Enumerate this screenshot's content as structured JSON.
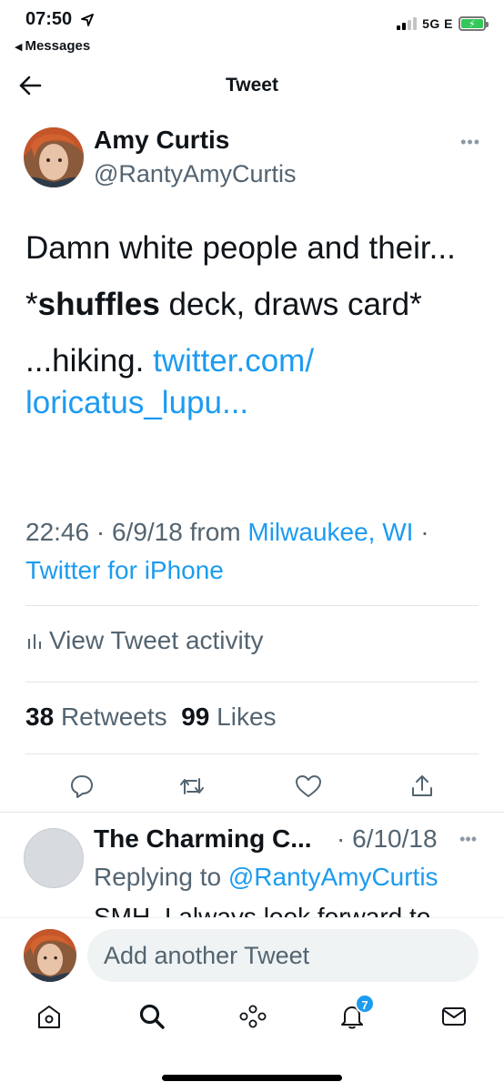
{
  "status": {
    "time": "07:50",
    "back_app": "Messages",
    "network": "5G E"
  },
  "nav": {
    "title": "Tweet"
  },
  "tweet": {
    "author_name": "Amy Curtis",
    "author_handle": "@RantyAmyCurtis",
    "line1": "Damn white people and their...",
    "line2_prefix": "*",
    "line2_bold": "shuffles",
    "line2_rest": " deck, draws card*",
    "line3_text": "...hiking. ",
    "line3_link": "twitter.com/ loricatus_lupu...",
    "time": "22:46",
    "date": "6/9/18",
    "from_label": "from",
    "location": "Milwaukee, WI",
    "client": "Twitter for iPhone"
  },
  "activity": {
    "label": "View Tweet activity"
  },
  "stats": {
    "retweets_count": "38",
    "retweets_label": "Retweets",
    "likes_count": "99",
    "likes_label": "Likes"
  },
  "reply": {
    "name": "The Charming C...",
    "date": "· 6/10/18",
    "replying_label": "Replying to",
    "replying_handle": "@RantyAmyCurtis",
    "body_preview": "SMH. I always look forward to"
  },
  "composer": {
    "placeholder": "Add another Tweet"
  },
  "tabbar": {
    "notifications_badge": "7"
  },
  "colors": {
    "accent": "#1d9bf0",
    "secondary_text": "#536471",
    "primary_text": "#0f1419"
  }
}
